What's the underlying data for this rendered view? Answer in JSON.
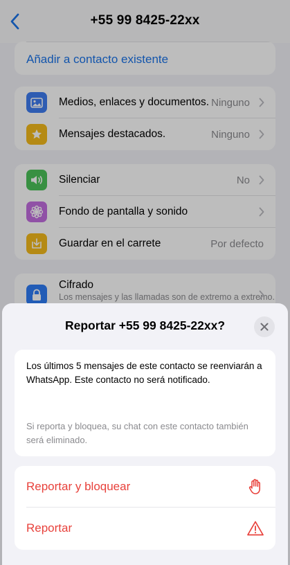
{
  "header": {
    "title": "+55 99 8425-22xx"
  },
  "contact_actions": {
    "add_existing": "Añadir a contacto existente"
  },
  "media_section": [
    {
      "label": "Medios, enlaces y documentos.",
      "value": "Ninguno",
      "icon": "photo-icon"
    },
    {
      "label": "Mensajes destacados.",
      "value": "Ninguno",
      "icon": "star-icon"
    }
  ],
  "settings_section": [
    {
      "label": "Silenciar",
      "value": "No",
      "icon": "speaker-icon"
    },
    {
      "label": "Fondo de pantalla y sonido",
      "value": "",
      "icon": "flower-icon"
    },
    {
      "label": "Guardar en el carrete",
      "value": "Por defecto",
      "icon": "save-icon"
    }
  ],
  "encryption": {
    "title": "Cifrado",
    "subtitle": "Los mensajes y las llamadas son de extremo a extremo."
  },
  "sheet": {
    "title": "Reportar +55 99 8425-22xx?",
    "info_main": "Los últimos 5 mensajes de este contacto se reenviarán a WhatsApp. Este contacto no será notificado.",
    "info_secondary": "Si reporta y bloquea, su chat con este contacto también será eliminado.",
    "actions": [
      {
        "label": "Reportar y bloquear",
        "icon": "hand-stop-icon"
      },
      {
        "label": "Reportar",
        "icon": "warning-icon"
      }
    ]
  },
  "colors": {
    "link_blue": "#1a73e8",
    "danger_red": "#e8413b",
    "icon_media": "#3f7df0",
    "icon_star": "#f4bb1b",
    "icon_mute": "#4cc35a",
    "icon_wallpaper": "#c36ee0",
    "icon_save": "#f4bb1b",
    "icon_lock": "#2f7cf6"
  }
}
